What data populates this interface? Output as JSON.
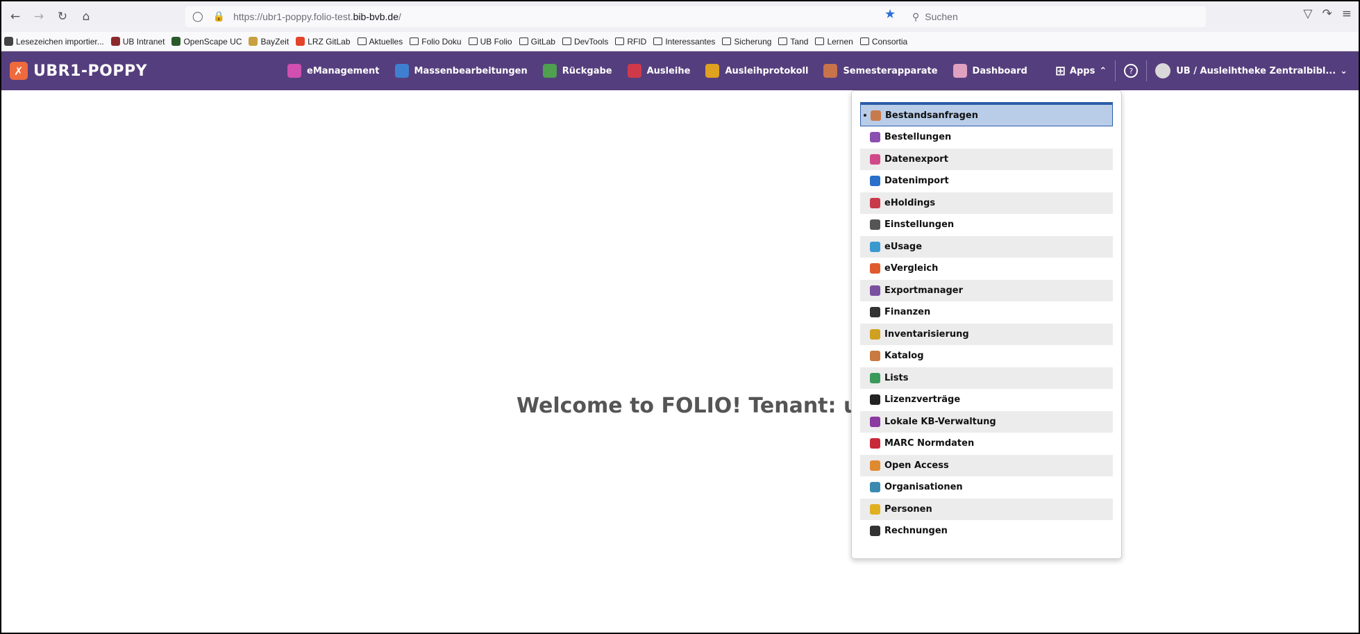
{
  "browser": {
    "url_prefix": "https://ubr1-poppy.folio-test.",
    "url_domain": "bib-bvb.de",
    "url_suffix": "/",
    "search_placeholder": "Suchen"
  },
  "bookmarks": [
    {
      "label": "Lesezeichen importier...",
      "color": "#444444"
    },
    {
      "label": "UB Intranet",
      "color": "#8b2a2a"
    },
    {
      "label": "OpenScape UC",
      "color": "#2a5a2a"
    },
    {
      "label": "BayZeit",
      "color": "#c8a040"
    },
    {
      "label": "LRZ GitLab",
      "color": "#e24329"
    },
    {
      "label": "Aktuelles",
      "color": ""
    },
    {
      "label": "Folio Doku",
      "color": ""
    },
    {
      "label": "UB Folio",
      "color": ""
    },
    {
      "label": "GitLab",
      "color": ""
    },
    {
      "label": "DevTools",
      "color": ""
    },
    {
      "label": "RFID",
      "color": ""
    },
    {
      "label": "Interessantes",
      "color": ""
    },
    {
      "label": "Sicherung",
      "color": ""
    },
    {
      "label": "Tand",
      "color": ""
    },
    {
      "label": "Lernen",
      "color": ""
    },
    {
      "label": "Consortia",
      "color": ""
    }
  ],
  "folio": {
    "brand": "UBR1-POPPY",
    "nav": [
      {
        "label": "eManagement",
        "color": "#d04fb0",
        "icon": "check-circle-icon"
      },
      {
        "label": "Massenbearbeitungen",
        "color": "#3f7fd0",
        "icon": "edit-icon"
      },
      {
        "label": "Rückgabe",
        "color": "#4fa04f",
        "icon": "return-icon"
      },
      {
        "label": "Ausleihe",
        "color": "#d0394a",
        "icon": "checkout-icon"
      },
      {
        "label": "Ausleihprotokoll",
        "color": "#e0a020",
        "icon": "log-icon"
      },
      {
        "label": "Semesterapparate",
        "color": "#c8734a",
        "icon": "book-icon"
      },
      {
        "label": "Dashboard",
        "color": "#e0a0c0",
        "icon": "dashboard-icon"
      }
    ],
    "apps_label": "Apps",
    "profile_label": "UB / Ausleihtheke Zentralbibl..."
  },
  "welcome": "Welcome to FOLIO! Tenant: ubr1",
  "apps_menu": [
    {
      "label": "Bestandsanfragen",
      "color": "#c97a4a",
      "active": true
    },
    {
      "label": "Bestellungen",
      "color": "#8a4fb0"
    },
    {
      "label": "Datenexport",
      "color": "#d04a8a"
    },
    {
      "label": "Datenimport",
      "color": "#2a6fc8"
    },
    {
      "label": "eHoldings",
      "color": "#c8394a"
    },
    {
      "label": "Einstellungen",
      "color": "#555555"
    },
    {
      "label": "eUsage",
      "color": "#3a9ad0"
    },
    {
      "label": "eVergleich",
      "color": "#e05a30"
    },
    {
      "label": "Exportmanager",
      "color": "#7a4fa0"
    },
    {
      "label": "Finanzen",
      "color": "#333333"
    },
    {
      "label": "Inventarisierung",
      "color": "#d0a020"
    },
    {
      "label": "Katalog",
      "color": "#c87a40"
    },
    {
      "label": "Lists",
      "color": "#3a9a5a"
    },
    {
      "label": "Lizenzverträge",
      "color": "#222222"
    },
    {
      "label": "Lokale KB-Verwaltung",
      "color": "#8a3aa0"
    },
    {
      "label": "MARC Normdaten",
      "color": "#c82a3a"
    },
    {
      "label": "Open Access",
      "color": "#e08a30"
    },
    {
      "label": "Organisationen",
      "color": "#3a8ab0"
    },
    {
      "label": "Personen",
      "color": "#e0b020"
    },
    {
      "label": "Rechnungen",
      "color": "#333333"
    }
  ]
}
